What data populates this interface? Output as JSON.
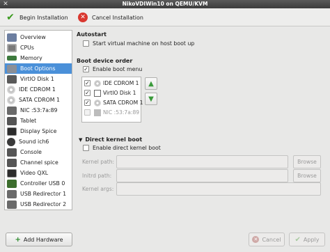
{
  "window": {
    "title": "NikoVDIWin10 on QEMU/KVM"
  },
  "toolbar": {
    "begin_label": "Begin Installation",
    "cancel_label": "Cancel Installation"
  },
  "sidebar": {
    "items": [
      {
        "label": "Overview",
        "icon": "overview-icon"
      },
      {
        "label": "CPUs",
        "icon": "cpu-icon"
      },
      {
        "label": "Memory",
        "icon": "memory-icon"
      },
      {
        "label": "Boot Options",
        "icon": "boot-options-icon",
        "selected": true
      },
      {
        "label": "VirtIO Disk 1",
        "icon": "disk-icon"
      },
      {
        "label": "IDE CDROM 1",
        "icon": "cdrom-icon"
      },
      {
        "label": "SATA CDROM 1",
        "icon": "cdrom-icon"
      },
      {
        "label": "NIC :53:7a:89",
        "icon": "nic-icon"
      },
      {
        "label": "Tablet",
        "icon": "tablet-icon"
      },
      {
        "label": "Display Spice",
        "icon": "display-icon"
      },
      {
        "label": "Sound ich6",
        "icon": "sound-icon"
      },
      {
        "label": "Console",
        "icon": "console-icon"
      },
      {
        "label": "Channel spice",
        "icon": "channel-icon"
      },
      {
        "label": "Video QXL",
        "icon": "video-icon"
      },
      {
        "label": "Controller USB 0",
        "icon": "controller-icon"
      },
      {
        "label": "USB Redirector 1",
        "icon": "usb-redirector-icon"
      },
      {
        "label": "USB Redirector 2",
        "icon": "usb-redirector-icon"
      }
    ],
    "add_hardware_label": "Add Hardware"
  },
  "autostart": {
    "heading": "Autostart",
    "option_label": "Start virtual machine on host boot up",
    "checked": false
  },
  "boot": {
    "heading": "Boot device order",
    "enable_menu_label": "Enable boot menu",
    "enable_menu_checked": true,
    "devices": [
      {
        "label": "IDE CDROM 1",
        "checked": true,
        "enabled": true
      },
      {
        "label": "VirtIO Disk 1",
        "checked": true,
        "enabled": true
      },
      {
        "label": "SATA CDROM 1",
        "checked": true,
        "enabled": true
      },
      {
        "label": "NIC :53:7a:89",
        "checked": false,
        "enabled": false
      }
    ]
  },
  "direct_kernel": {
    "heading": "Direct kernel boot",
    "enable_label": "Enable direct kernel boot",
    "enabled": false,
    "kernel_path_label": "Kernel path:",
    "initrd_path_label": "Initrd path:",
    "kernel_args_label": "Kernel args:",
    "browse_label": "Browse"
  },
  "buttons": {
    "cancel_label": "Cancel",
    "apply_label": "Apply"
  },
  "colors": {
    "selection": "#4a90d9",
    "titlebar": "#3c3c3c",
    "cancel_icon": "#d9372f",
    "begin_icon": "#3a9a1e"
  }
}
